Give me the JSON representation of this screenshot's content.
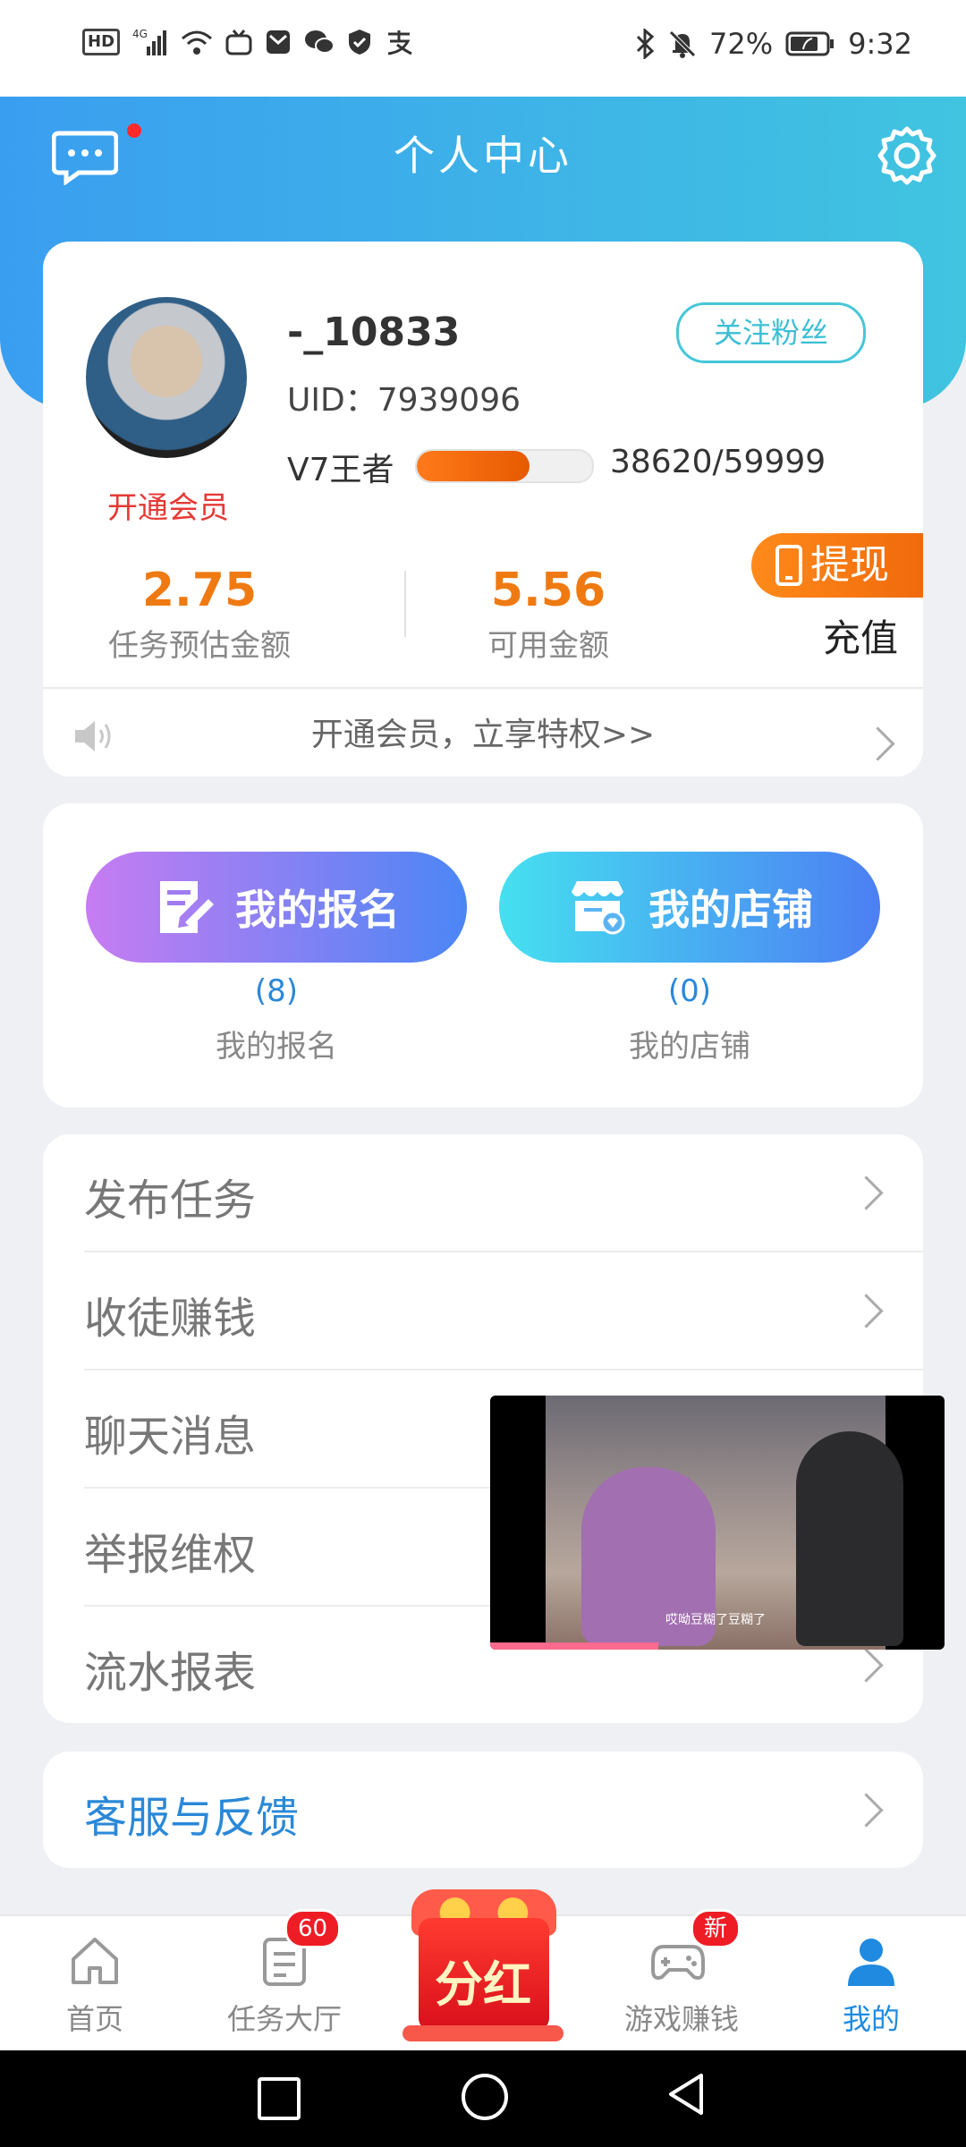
{
  "status_bar": {
    "left_icons": [
      "hd-icon",
      "4g-signal-icon",
      "wifi-icon",
      "tv-icon",
      "message-icon",
      "wechat-icon",
      "shield-icon",
      "alipay-icon"
    ],
    "battery": "72%",
    "time": "9:32"
  },
  "header": {
    "title": "个人中心"
  },
  "profile": {
    "username": "-_10833",
    "uid_label": "UID：7939096",
    "follow_label": "关注粉丝",
    "vip_label": "开通会员",
    "level_name": "V7王者",
    "level_progress_fraction": 0.6437,
    "level_progress_text": "38620/59999",
    "stats": [
      {
        "value": "2.75",
        "label": "任务预估金额"
      },
      {
        "value": "5.56",
        "label": "可用金额"
      }
    ],
    "withdraw_label": "提现",
    "recharge_label": "充值",
    "notice_text": "开通会员，立享特权>>"
  },
  "shortcuts": [
    {
      "button_label": "我的报名",
      "count": "(8)",
      "label": "我的报名"
    },
    {
      "button_label": "我的店铺",
      "count": "(0)",
      "label": "我的店铺"
    }
  ],
  "menu": [
    {
      "label": "发布任务"
    },
    {
      "label": "收徒赚钱"
    },
    {
      "label": "聊天消息"
    },
    {
      "label": "举报维权"
    },
    {
      "label": "流水报表"
    }
  ],
  "service": {
    "label": "客服与反馈"
  },
  "video": {
    "caption": "哎呦豆糊了豆糊了",
    "progress_fraction": 0.37
  },
  "bottom_nav": [
    {
      "label": "首页",
      "icon": "home-icon"
    },
    {
      "label": "任务大厅",
      "icon": "task-icon",
      "badge": "60"
    },
    {
      "label": "分红",
      "icon": "dividend-icon"
    },
    {
      "label": "游戏赚钱",
      "icon": "gamepad-icon",
      "badge": "新"
    },
    {
      "label": "我的",
      "icon": "user-icon",
      "active": true
    }
  ],
  "colors": {
    "accent": "#3a9ef0",
    "orange": "#ef7a12",
    "link": "#2a88d8"
  }
}
